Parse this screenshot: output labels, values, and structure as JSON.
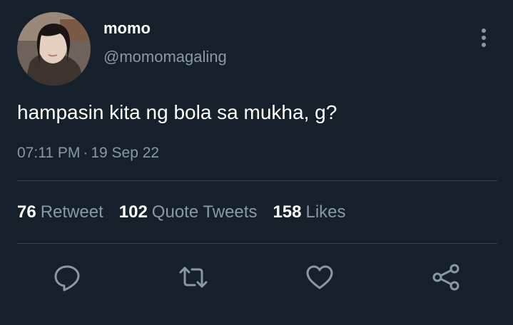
{
  "tweet": {
    "display_name": "momo",
    "handle": "@momomagaling",
    "text": "hampasin kita ng bola sa mukha, g?",
    "time": "07:11 PM",
    "separator": "·",
    "date": "19 Sep 22"
  },
  "stats": {
    "retweets": {
      "count": "76",
      "label": "Retweet"
    },
    "quotes": {
      "count": "102",
      "label": "Quote Tweets"
    },
    "likes": {
      "count": "158",
      "label": "Likes"
    }
  },
  "icons": {
    "reply": "reply-icon",
    "retweet": "retweet-icon",
    "like": "heart-icon",
    "share": "share-icon",
    "more": "more-vertical-icon"
  },
  "colors": {
    "background": "#15202b",
    "secondary_text": "#8899a6",
    "divider": "#38444d",
    "icon": "#8899a6"
  }
}
